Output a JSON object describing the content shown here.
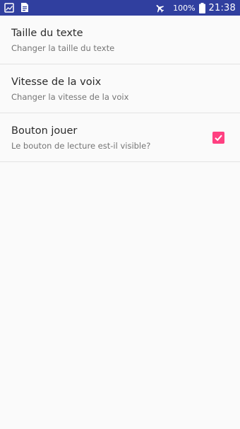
{
  "status_bar": {
    "battery_text": "100%",
    "time": "21:38",
    "color": "#303f9f",
    "icons": [
      "image-notification-icon",
      "document-notification-icon",
      "airplane-mode-icon",
      "battery-icon"
    ]
  },
  "settings": {
    "items": [
      {
        "title": "Taille du texte",
        "summary": "Changer la taille du texte"
      },
      {
        "title": "Vitesse de la voix",
        "summary": "Changer la vitesse de la voix"
      },
      {
        "title": "Bouton jouer",
        "summary": "Le bouton de lecture est-il visible?",
        "checked": true,
        "accent": "#ff4081"
      }
    ]
  }
}
